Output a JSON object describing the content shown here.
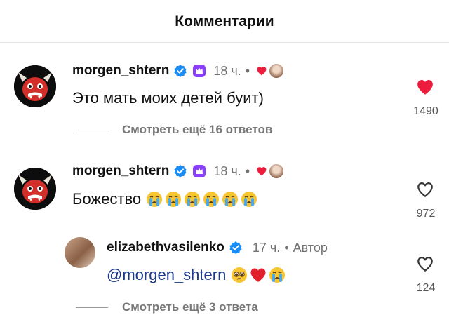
{
  "header": {
    "title": "Комментарии"
  },
  "comments": [
    {
      "username": "morgen_shtern",
      "time": "18 ч.",
      "dot": "•",
      "text": "Это мать моих детей буит)",
      "likes": "1490",
      "liked": true,
      "view_replies": "Смотреть ещё 16 ответов"
    },
    {
      "username": "morgen_shtern",
      "time": "18 ч.",
      "dot": "•",
      "text": "Божество",
      "emojis": [
        "loudly-crying-face",
        "loudly-crying-face",
        "loudly-crying-face",
        "loudly-crying-face",
        "loudly-crying-face",
        "loudly-crying-face"
      ],
      "likes": "972",
      "liked": false,
      "reply": {
        "username": "elizabethvasilenko",
        "time": "17 ч.",
        "dot": "•",
        "author_label": "Автор",
        "mention": "@morgen_shtern",
        "emojis": [
          "pleading-face",
          "red-heart",
          "loudly-crying-face"
        ],
        "likes": "124",
        "liked": false
      },
      "view_replies": "Смотреть ещё 3 ответа"
    }
  ],
  "colors": {
    "like_red": "#ed1c3c",
    "verified_blue": "#1a8cf5",
    "sub_purple": "#8a3ffc"
  }
}
